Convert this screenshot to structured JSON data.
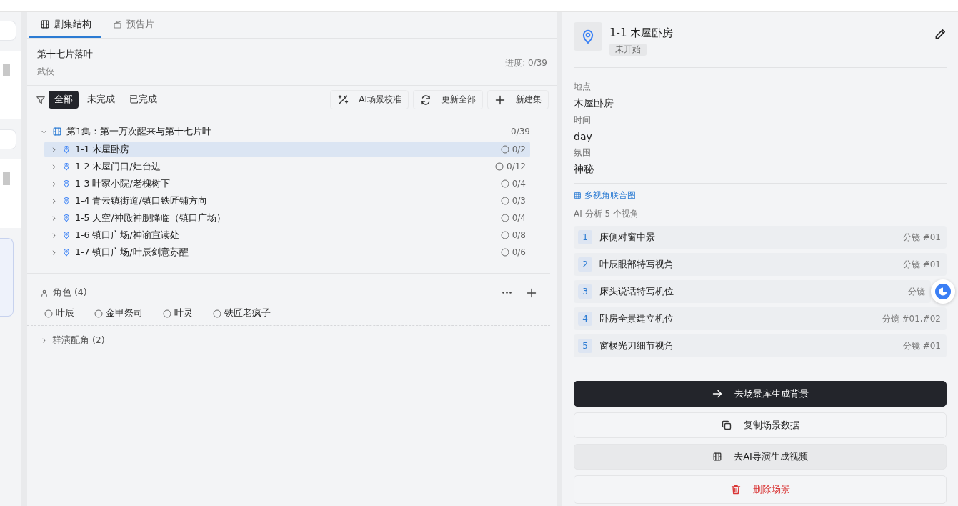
{
  "tabs": [
    {
      "label": "剧集结构",
      "selected": true
    },
    {
      "label": "预告片",
      "selected": false
    }
  ],
  "project": {
    "title": "第十七片落叶",
    "genre": "武侠",
    "progress": "进度: 0/39"
  },
  "filters": [
    {
      "label": "全部",
      "selected": true
    },
    {
      "label": "未完成",
      "selected": false
    },
    {
      "label": "已完成",
      "selected": false
    }
  ],
  "actions": [
    {
      "label": "AI场景校准"
    },
    {
      "label": "更新全部"
    },
    {
      "label": "新建集"
    }
  ],
  "episodes": [
    {
      "title": "第1集：第一万次醒来与第十七片叶",
      "count": "0/39",
      "expanded": true,
      "children": [
        {
          "title": "1-1 木屋卧房",
          "count": "0/2",
          "selected": true,
          "expanded": false
        },
        {
          "title": "1-2 木屋门口/灶台边",
          "count": "0/12",
          "selected": false,
          "expanded": false
        },
        {
          "title": "1-3 叶家小院/老槐树下",
          "count": "0/4",
          "selected": false,
          "expanded": false
        },
        {
          "title": "1-4 青云镇街道/镇口铁匠铺方向",
          "count": "0/3",
          "selected": false,
          "expanded": false
        },
        {
          "title": "1-5 天空/神殿神舰降临（镇口广场）",
          "count": "0/4",
          "selected": false,
          "expanded": false
        },
        {
          "title": "1-6 镇口广场/神谕宣读处",
          "count": "0/8",
          "selected": false,
          "expanded": false
        },
        {
          "title": "1-7 镇口广场/叶辰剑意苏醒",
          "count": "0/6",
          "selected": false,
          "expanded": false
        }
      ]
    }
  ],
  "roles": {
    "title": "角色 (4)",
    "items": [
      {
        "name": "叶辰",
        "selected": false
      },
      {
        "name": "金甲祭司",
        "selected": false
      },
      {
        "name": "叶灵",
        "selected": false
      },
      {
        "name": "铁匠老疯子",
        "selected": false
      }
    ]
  },
  "extras": {
    "title": "群演配角 (2)",
    "expanded": false
  },
  "detail": {
    "title": "1-1 木屋卧房",
    "status": "未开始",
    "fields": [
      {
        "label": "地点",
        "value": "木屋卧房"
      },
      {
        "label": "时间",
        "value": "day"
      },
      {
        "label": "氛围",
        "value": "神秘"
      }
    ],
    "link": "多视角联合图",
    "summary": "AI 分析 5 个视角",
    "views": [
      {
        "index": "1",
        "name": "床侧对窗中景",
        "ref": "分镜 #01"
      },
      {
        "index": "2",
        "name": "叶辰眼部特写视角",
        "ref": "分镜 #01"
      },
      {
        "index": "3",
        "name": "床头说话特写机位",
        "ref": "分镜"
      },
      {
        "index": "4",
        "name": "卧房全景建立机位",
        "ref": "分镜 #01,#02"
      },
      {
        "index": "5",
        "name": "窗棂光刀细节视角",
        "ref": "分镜 #01"
      }
    ],
    "buttons": [
      {
        "label": "去场景库生成背景",
        "kind": "primary"
      },
      {
        "label": "复制场景数据",
        "kind": "secondary"
      },
      {
        "label": "去AI导演生成视频",
        "kind": "muted"
      },
      {
        "label": "删除场景",
        "kind": "danger"
      }
    ]
  }
}
